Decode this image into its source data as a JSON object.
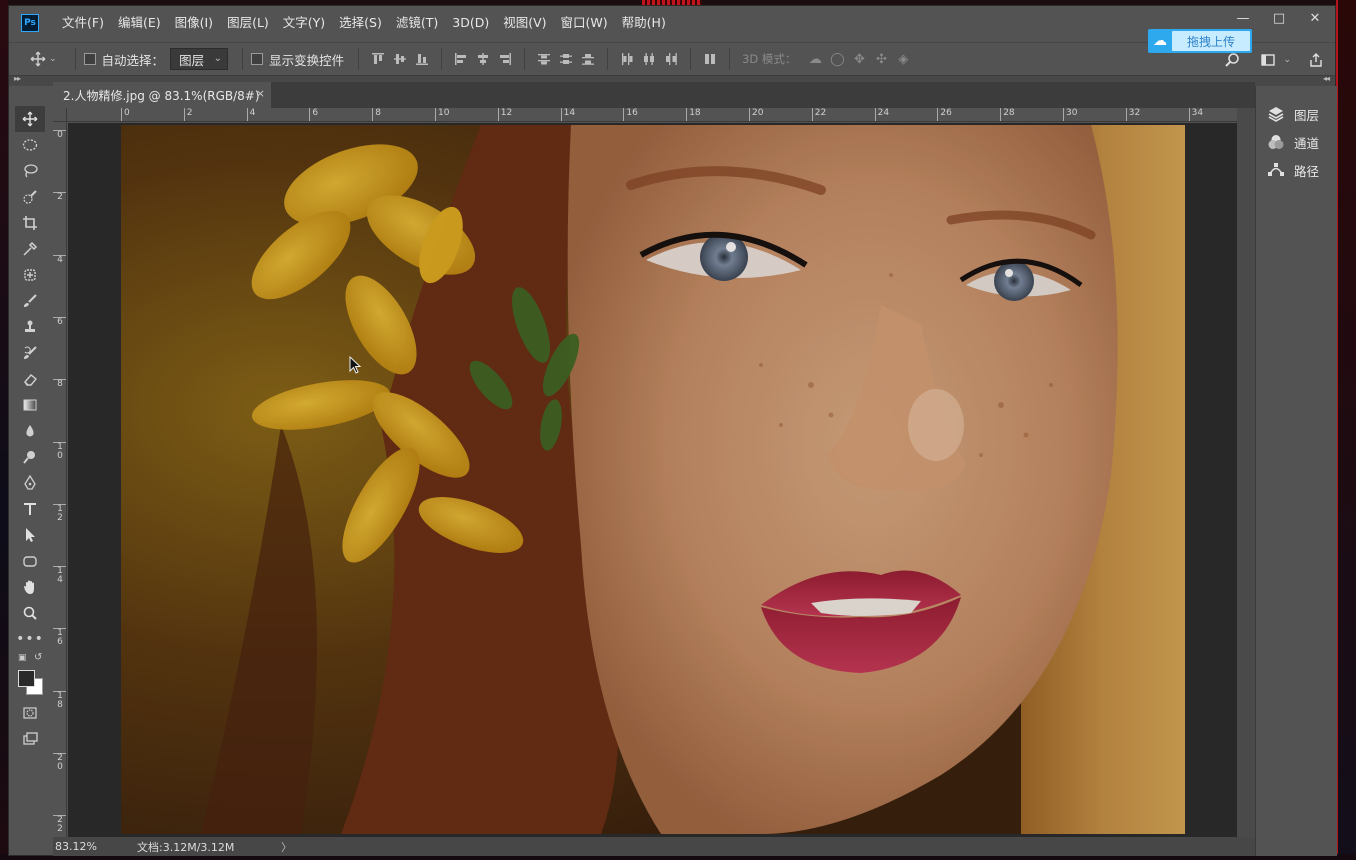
{
  "app": {
    "logo": "Ps",
    "menu": [
      "文件(F)",
      "编辑(E)",
      "图像(I)",
      "图层(L)",
      "文字(Y)",
      "选择(S)",
      "滤镜(T)",
      "3D(D)",
      "视图(V)",
      "窗口(W)",
      "帮助(H)"
    ],
    "window_controls": [
      "minimize-icon",
      "maximize-icon",
      "close-icon"
    ]
  },
  "options": {
    "auto_select_label": "自动选择：",
    "auto_select_value": "图层",
    "show_transform_label": "显示变换控件",
    "mode_3d_label": "3D 模式：",
    "upload_label": "拖拽上传"
  },
  "document": {
    "tab_title": "2.人物精修.jpg @ 83.1%(RGB/8#)",
    "close_glyph": "×",
    "ruler_h": [
      "0",
      "2",
      "4",
      "6",
      "8",
      "10",
      "12",
      "14",
      "16",
      "18",
      "20",
      "22",
      "24",
      "26",
      "28",
      "30",
      "32",
      "34"
    ],
    "ruler_v": [
      "0",
      "2",
      "4",
      "6",
      "8",
      "1\n0",
      "1\n2",
      "1\n4",
      "1\n6",
      "1\n8",
      "2\n0",
      "2\n2"
    ]
  },
  "status": {
    "zoom": "83.12%",
    "doc_size": "文档:3.12M/3.12M",
    "arrow": "〉"
  },
  "panels": [
    {
      "label": "图层",
      "icon": "layers-icon"
    },
    {
      "label": "通道",
      "icon": "channels-icon"
    },
    {
      "label": "路径",
      "icon": "paths-icon"
    }
  ],
  "colors": {
    "ui_bg": "#535353",
    "pasteboard": "#282828",
    "accent_upload": "#2fa9ee"
  }
}
